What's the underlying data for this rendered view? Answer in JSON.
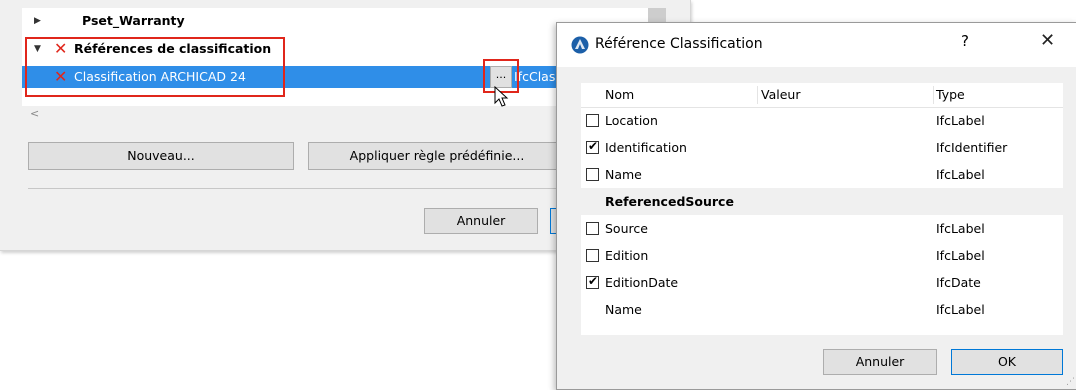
{
  "background_dialog": {
    "tree": [
      {
        "label": "Pset_Warranty",
        "expanded": false,
        "invalid": false,
        "selected": false
      },
      {
        "label": "Références de classification",
        "expanded": true,
        "invalid": true,
        "selected": false
      },
      {
        "label": "Classification ARCHICAD 24",
        "expanded": false,
        "invalid": true,
        "selected": true
      }
    ],
    "ellipsis_label": "...",
    "type_clipped": "IfcClas",
    "scroll_left_arrow": "<",
    "buttons": {
      "new": "Nouveau...",
      "apply_rule": "Appliquer règle prédéfinie...",
      "cancel": "Annuler"
    }
  },
  "ref_dialog": {
    "title": "Référence Classification",
    "help": "?",
    "close": "✕",
    "columns": {
      "name": "Nom",
      "value": "Valeur",
      "type": "Type"
    },
    "rows": [
      {
        "name": "Location",
        "type": "IfcLabel",
        "checkbox": true,
        "checked": false
      },
      {
        "name": "Identification",
        "type": "IfcIdentifier",
        "checkbox": true,
        "checked": true
      },
      {
        "name": "Name",
        "type": "IfcLabel",
        "checkbox": true,
        "checked": false
      },
      {
        "name": "ReferencedSource",
        "type": "",
        "section": true
      },
      {
        "name": "Source",
        "type": "IfcLabel",
        "checkbox": true,
        "checked": false
      },
      {
        "name": "Edition",
        "type": "IfcLabel",
        "checkbox": true,
        "checked": false
      },
      {
        "name": "EditionDate",
        "type": "IfcDate",
        "checkbox": true,
        "checked": true
      },
      {
        "name": "Name",
        "type": "IfcLabel",
        "checkbox": false,
        "checked": false
      }
    ],
    "cancel_label": "Annuler",
    "ok_label": "OK",
    "check_glyph": "✔"
  },
  "colors": {
    "selection": "#2f8ee8",
    "error_red": "#e0261b",
    "ok_border": "#0078d7"
  }
}
